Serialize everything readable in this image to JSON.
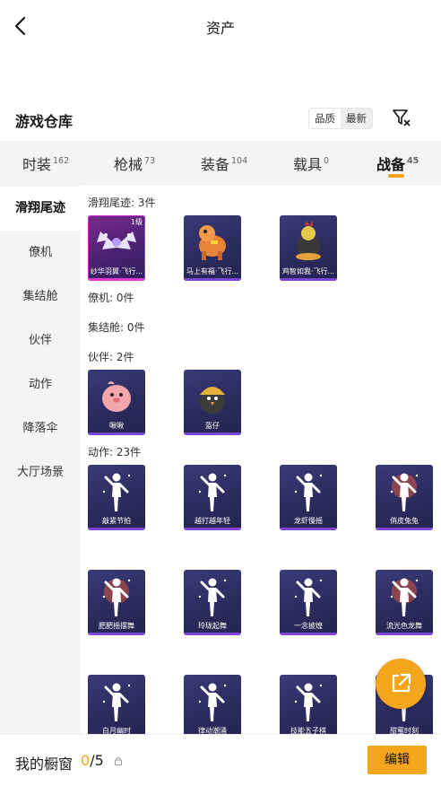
{
  "header": {
    "title": "资产"
  },
  "warehouse": {
    "title": "游戏仓库",
    "sort_options": [
      "品质",
      "最新"
    ],
    "active_sort": "最新",
    "filter_icon": "filter-icon"
  },
  "tabs": [
    {
      "label": "时装",
      "count": "162"
    },
    {
      "label": "枪械",
      "count": "73"
    },
    {
      "label": "装备",
      "count": "104"
    },
    {
      "label": "载具",
      "count": "0"
    },
    {
      "label": "战备",
      "count": "45",
      "active": true
    }
  ],
  "sidebar": [
    {
      "label": "滑翔尾迹",
      "active": true
    },
    {
      "label": "僚机"
    },
    {
      "label": "集结舱"
    },
    {
      "label": "伙伴"
    },
    {
      "label": "动作"
    },
    {
      "label": "降落伞"
    },
    {
      "label": "大厅场景"
    }
  ],
  "sections": {
    "trail": {
      "header": "滑翔尾迹: 3件",
      "items": [
        {
          "name": "纱华羽翼·飞行...",
          "level": "1级",
          "art": "winged-bat-trail"
        },
        {
          "name": "马上有福·飞行...",
          "art": "lucky-horse-trail"
        },
        {
          "name": "鸡智如我·飞行...",
          "art": "rooster-trail"
        }
      ]
    },
    "wingman": {
      "header": "僚机: 0件"
    },
    "pod": {
      "header": "集结舱: 0件"
    },
    "partner": {
      "header": "伙伴: 2件",
      "items": [
        {
          "name": "啾啾",
          "art": "pink-bird"
        },
        {
          "name": "盔仔",
          "art": "helmet-bird"
        }
      ]
    },
    "emote": {
      "header": "动作: 23件",
      "items": [
        {
          "name": "敲紧节拍",
          "art": "dance-pose"
        },
        {
          "name": "越打越年轻",
          "art": "dance-pose"
        },
        {
          "name": "龙虾慢摇",
          "art": "dance-pose"
        },
        {
          "name": "俏皮兔兔",
          "art": "dance-pose"
        },
        {
          "name": "肥肥摇摆舞",
          "art": "dance-pose"
        },
        {
          "name": "玲珑起舞",
          "art": "dance-pose"
        },
        {
          "name": "一念披煌",
          "art": "dance-pose"
        },
        {
          "name": "流光色龙舞",
          "art": "dance-pose"
        },
        {
          "name": "白月幽时",
          "art": "dance-pose"
        },
        {
          "name": "律动潮涌",
          "art": "dance-pose"
        },
        {
          "name": "技能五子棋",
          "art": "dance-pose"
        },
        {
          "name": "甜蜜时刻",
          "art": "dance-pose"
        }
      ]
    }
  },
  "showcase": {
    "label": "我的橱窗",
    "current": "0",
    "separator": "/",
    "total": "5",
    "edit_label": "编辑"
  },
  "colors": {
    "accent": "#f3a51c",
    "card_bg": "#2f2f66",
    "rare_border": "#c62ccd"
  }
}
